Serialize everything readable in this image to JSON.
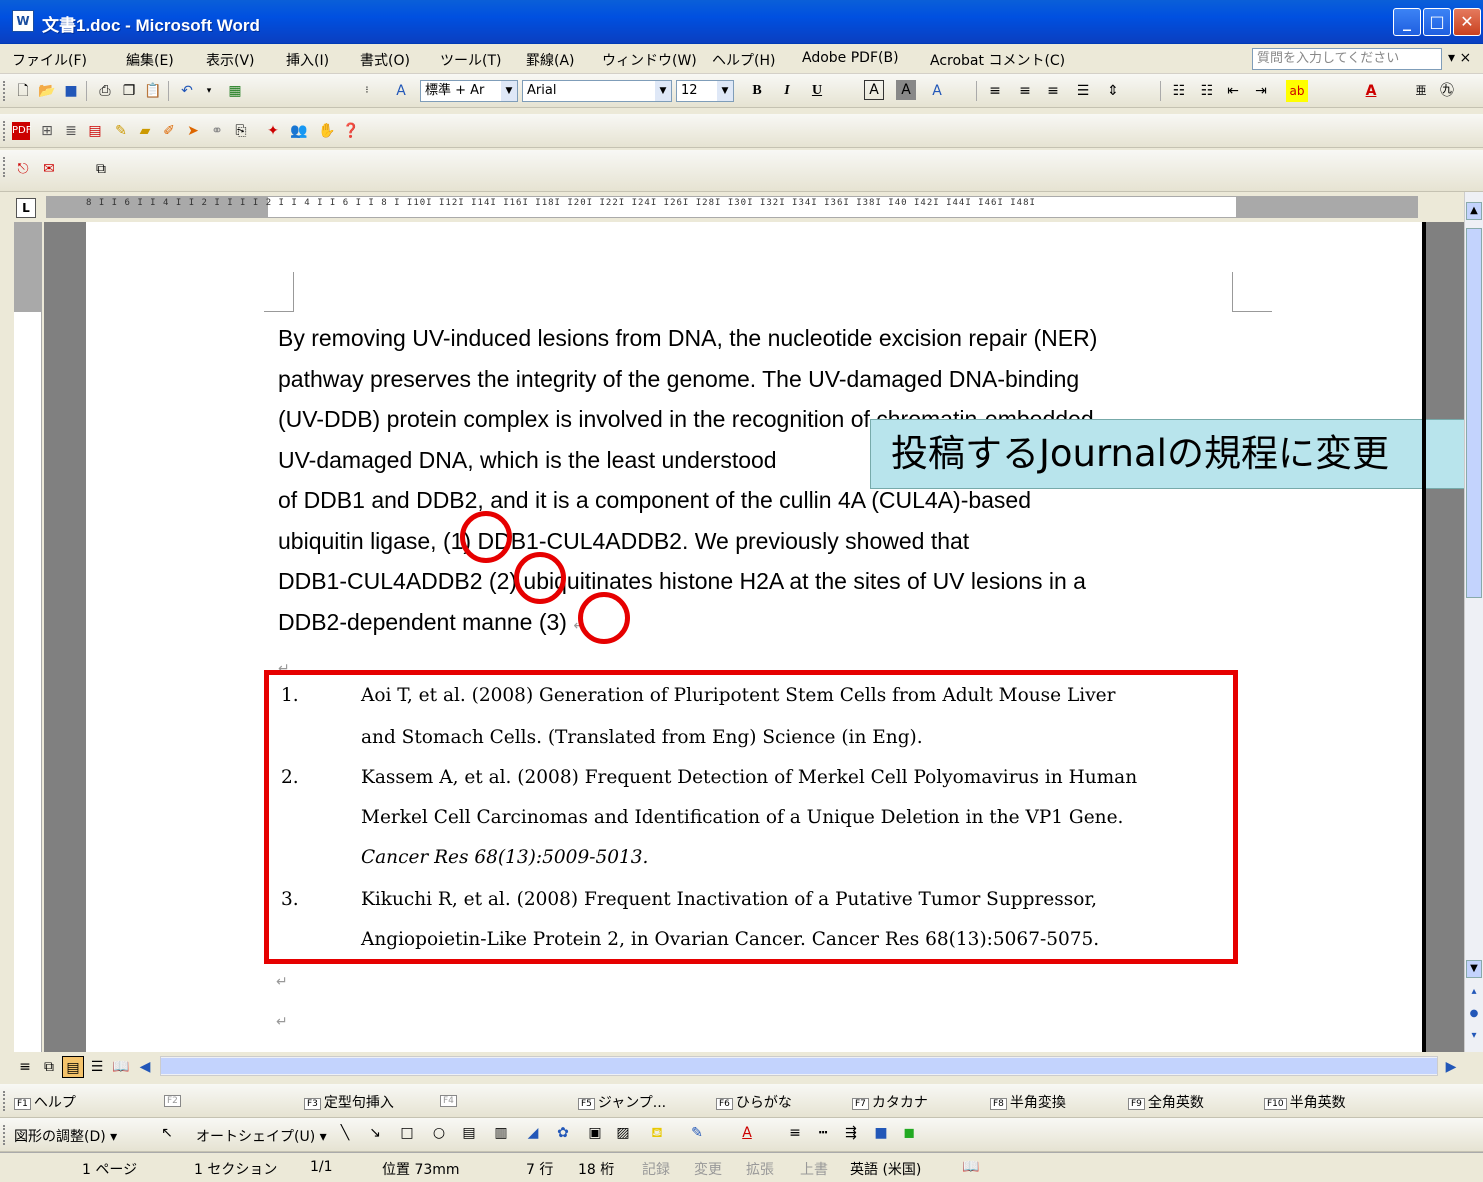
{
  "window": {
    "title": "文書1.doc - Microsoft Word",
    "app_icon": "word-doc-icon"
  },
  "menu": {
    "items": [
      "ファイル(F)",
      "編集(E)",
      "表示(V)",
      "挿入(I)",
      "書式(O)",
      "ツール(T)",
      "罫線(A)",
      "ウィンドウ(W)",
      "ヘルプ(H)",
      "Adobe PDF(B)",
      "Acrobat コメント(C)"
    ],
    "help_placeholder": "質問を入力してください"
  },
  "formatting_toolbar": {
    "style": "標準 + Ar",
    "font": "Arial",
    "size": "12",
    "bold": "B",
    "italic": "I",
    "underline": "U"
  },
  "document": {
    "paragraph": [
      "By removing UV-induced lesions from DNA, the nucleotide excision repair (NER)",
      "pathway preserves the integrity of the genome. The UV-damaged DNA-binding",
      "(UV-DDB) protein complex is involved in the recognition of chromatin-embedded",
      "UV-damaged DNA, which is the least understood",
      "of DDB1 and DDB2, and it is a component of the cullin 4A (CUL4A)-based",
      "ubiquitin ligase,",
      "DDB1-CUL4ADDB2. We previously showed that",
      "DDB1-CUL4ADDB2",
      "ubiquitinates histone H2A at the sites of UV lesions in a",
      "DDB2-dependent manne"
    ],
    "citations": [
      "(1)",
      "(2)",
      "(3)"
    ],
    "references": [
      {
        "num": "1.",
        "line1": "Aoi T, et al. (2008) Generation of Pluripotent Stem Cells from Adult Mouse Liver",
        "line2": "and Stomach Cells. (Translated from Eng) Science   (in Eng)."
      },
      {
        "num": "2.",
        "line1": "Kassem A, et al. (2008) Frequent Detection of Merkel Cell Polyomavirus in Human",
        "line2": "Merkel Cell Carcinomas and Identification of a Unique Deletion in the VP1 Gene.",
        "line3": "Cancer Res 68(13):5009-5013."
      },
      {
        "num": "3.",
        "line1": "Kikuchi R, et al. (2008) Frequent Inactivation of a Putative Tumor Suppressor,",
        "line2": "Angiopoietin-Like Protein 2, in Ovarian Cancer. Cancer Res 68(13):5067-5075."
      }
    ],
    "callout": "投稿するJournalの規程に変更"
  },
  "ruler": {
    "numbers": "8 I  I 6 I  I 4 I  I 2 I  I     I  I 2 I  I 4 I  I 6 I  I 8 I  I10I  I12I  I14I  I16I  I18I  I20I  I22I  I24I  I26I  I28I  I30I  I32I  I34I  I36I  I38I  I40   I42I  I44I  I46I  I48I"
  },
  "function_keys": [
    {
      "key": "F1",
      "label": "ヘルプ"
    },
    {
      "key": "F2",
      "label": ""
    },
    {
      "key": "F3",
      "label": "定型句挿入"
    },
    {
      "key": "F4",
      "label": ""
    },
    {
      "key": "F5",
      "label": "ジャンプ..."
    },
    {
      "key": "F6",
      "label": "ひらがな"
    },
    {
      "key": "F7",
      "label": "カタカナ"
    },
    {
      "key": "F8",
      "label": "半角変換"
    },
    {
      "key": "F9",
      "label": "全角英数"
    },
    {
      "key": "F10",
      "label": "半角英数"
    }
  ],
  "drawing_toolbar": {
    "adjust": "図形の調整(D) ▾",
    "autoshape": "オートシェイプ(U) ▾"
  },
  "status": {
    "page": "1 ページ",
    "section": "1 セクション",
    "pages": "1/1",
    "position": "位置 73mm",
    "line": "7 行",
    "col": "18 桁",
    "rec": "記録",
    "trk": "変更",
    "ext": "拡張",
    "ovr": "上書",
    "language": "英語 (米国)"
  }
}
